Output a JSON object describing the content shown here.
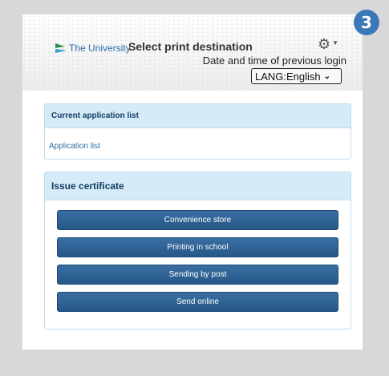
{
  "step_badge": "3",
  "header": {
    "logo_text": "The University",
    "title": "Select print destination",
    "prev_login": "Date and time of previous login",
    "lang_select_value": "LANG:English",
    "gear_icon": "gear-icon"
  },
  "current_apps": {
    "heading": "Current application list",
    "link": "Application list"
  },
  "issue_certificate": {
    "heading": "Issue certificate",
    "buttons": [
      "Convenience store",
      "Printing in school",
      "Sending by post",
      "Send online"
    ]
  },
  "colors": {
    "badge": "#3b78b8",
    "panel_header": "#d6ebf8",
    "button": "#265887",
    "link": "#2a6ea5"
  }
}
